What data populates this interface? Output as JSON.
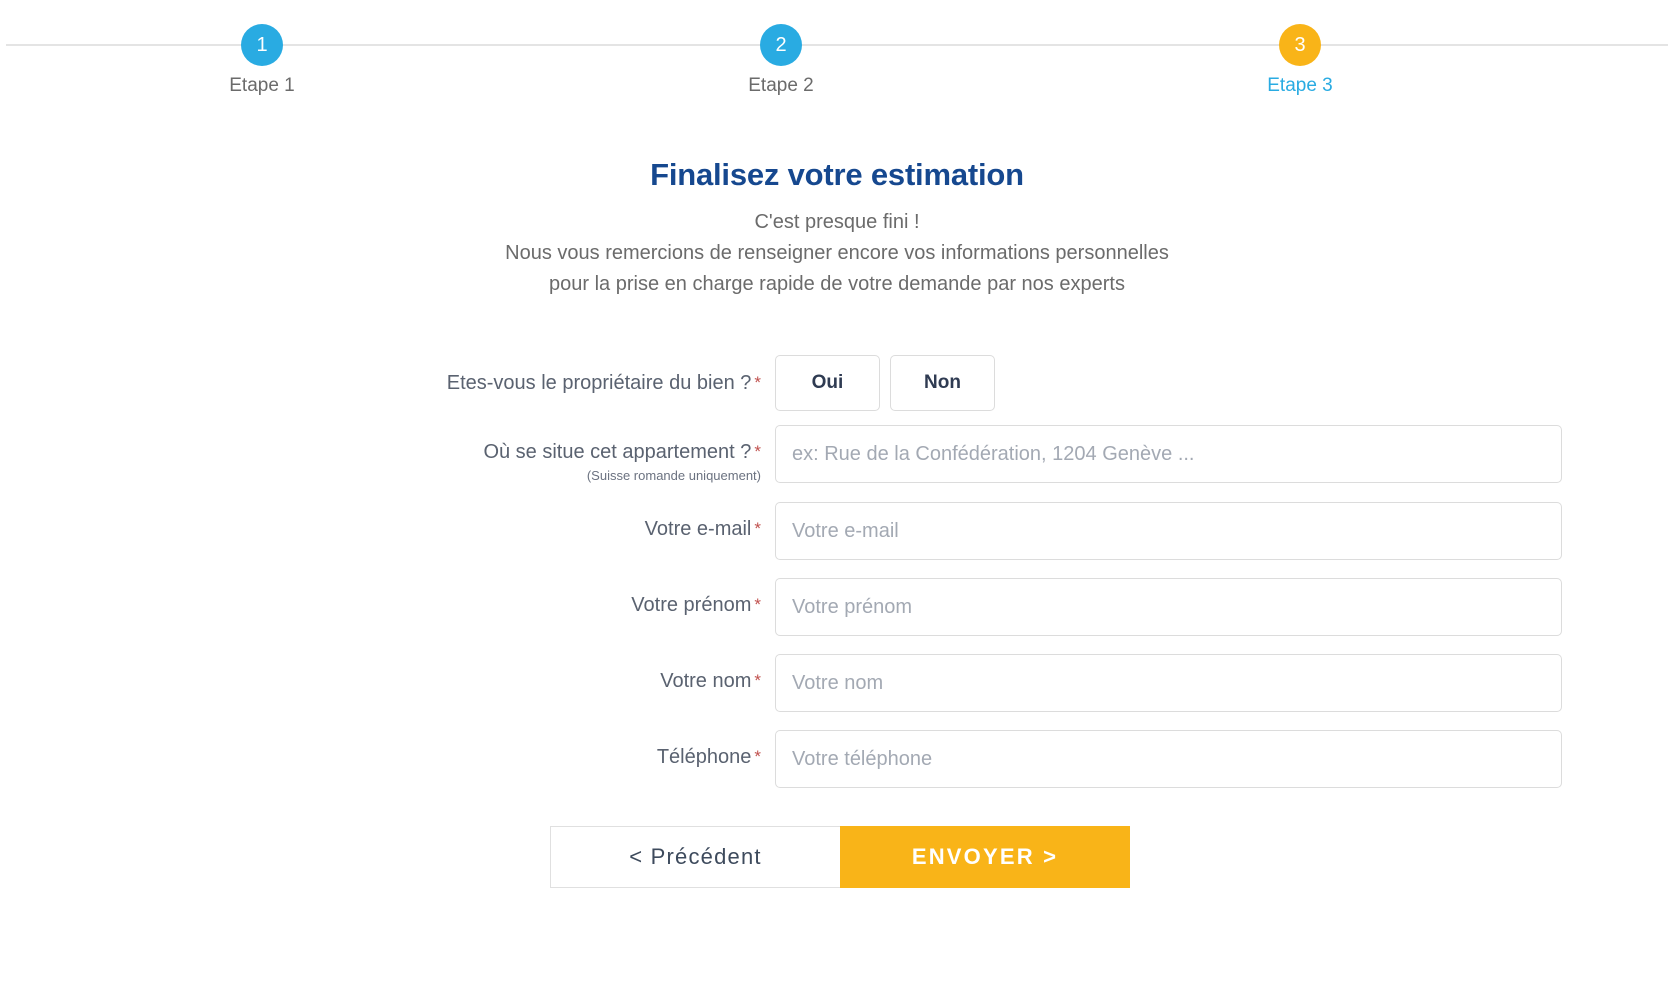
{
  "stepper": {
    "steps": [
      {
        "number": "1",
        "label": "Etape 1",
        "color": "#29abe2",
        "active": false
      },
      {
        "number": "2",
        "label": "Etape 2",
        "color": "#29abe2",
        "active": false
      },
      {
        "number": "3",
        "label": "Etape 3",
        "color": "#f9b418",
        "active": true
      }
    ]
  },
  "intro": {
    "title": "Finalisez votre estimation",
    "line1": "C'est presque fini !",
    "line2": "Nous vous remercions de renseigner encore vos informations personnelles",
    "line3": "pour la prise en charge rapide de votre demande par nos experts"
  },
  "form": {
    "owner": {
      "label": "Etes-vous le propriétaire du bien ?",
      "required_mark": "*",
      "yes_label": "Oui",
      "no_label": "Non"
    },
    "address": {
      "label": "Où se situe cet appartement ?",
      "required_mark": "*",
      "sublabel": "(Suisse romande uniquement)",
      "placeholder": "ex: Rue de la Confédération, 1204 Genève ...",
      "value": ""
    },
    "email": {
      "label": "Votre e-mail",
      "required_mark": "*",
      "placeholder": "Votre e-mail",
      "value": ""
    },
    "firstname": {
      "label": "Votre prénom",
      "required_mark": "*",
      "placeholder": "Votre prénom",
      "value": ""
    },
    "lastname": {
      "label": "Votre nom",
      "required_mark": "*",
      "placeholder": "Votre nom",
      "value": ""
    },
    "phone": {
      "label": "Téléphone",
      "required_mark": "*",
      "placeholder": "Votre téléphone",
      "value": ""
    }
  },
  "actions": {
    "previous_label": "<  Précédent",
    "send_label": "ENVOYER  >"
  },
  "colors": {
    "accent_blue": "#29abe2",
    "accent_amber": "#f9b418",
    "title_blue": "#16488f",
    "required_red": "#c0504d"
  }
}
